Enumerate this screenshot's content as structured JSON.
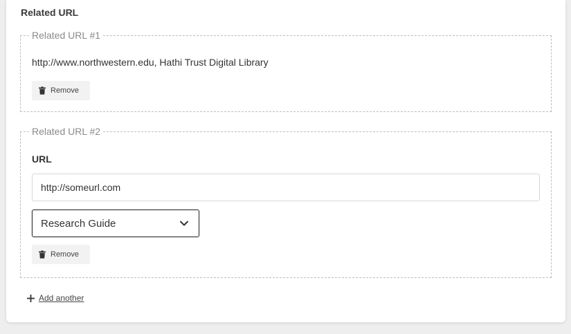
{
  "section": {
    "title": "Related URL"
  },
  "entries": [
    {
      "legend": "Related URL #1",
      "value_text": "http://www.northwestern.edu, Hathi Trust Digital Library",
      "remove_label": "Remove"
    },
    {
      "legend": "Related URL #2",
      "url_label": "URL",
      "url_value": "http://someurl.com",
      "type_selected": "Research Guide",
      "remove_label": "Remove"
    }
  ],
  "actions": {
    "add_another": "Add another"
  },
  "icons": {
    "remove": "trash-icon",
    "select": "chevron-down-icon",
    "add": "plus-icon"
  }
}
